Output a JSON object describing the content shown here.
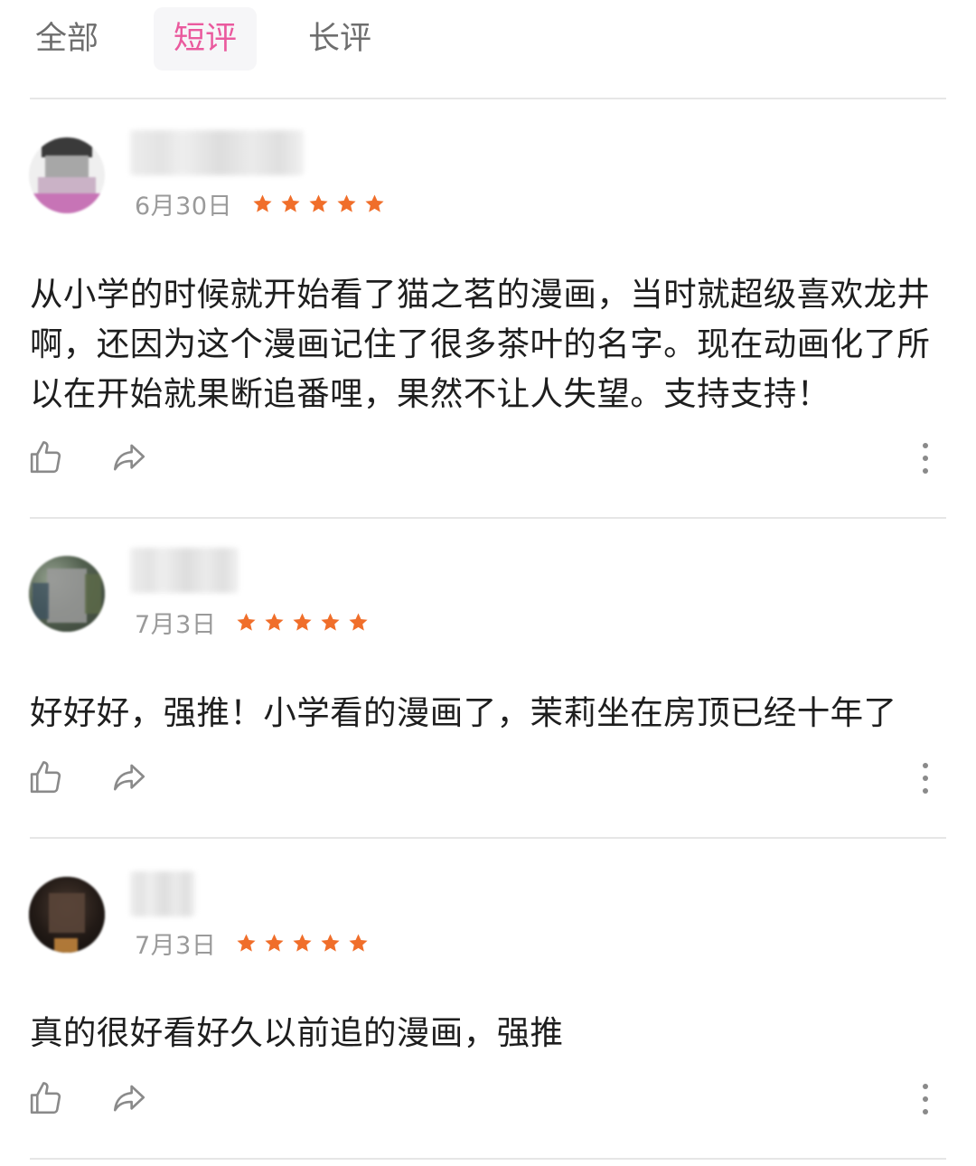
{
  "accent": "#ea5a9e",
  "star_color": "#f06e2a",
  "tabs": [
    {
      "label": "全部",
      "active": false
    },
    {
      "label": "短评",
      "active": true
    },
    {
      "label": "长评",
      "active": false
    }
  ],
  "reviews": [
    {
      "date": "6月30日",
      "rating": 5,
      "text": "从小学的时候就开始看了猫之茗的漫画，当时就超级喜欢龙井啊，还因为这个漫画记住了很多茶叶的名字。现在动画化了所以在开始就果断追番哩，果然不让人失望。支持支持！"
    },
    {
      "date": "7月3日",
      "rating": 5,
      "text": "好好好，强推！小学看的漫画了，茉莉坐在房顶已经十年了"
    },
    {
      "date": "7月3日",
      "rating": 5,
      "text": "真的很好看好久以前追的漫画，强推"
    }
  ],
  "icons": {
    "like": "thumbs-up-icon",
    "share": "share-icon",
    "more": "more-vertical-icon"
  }
}
